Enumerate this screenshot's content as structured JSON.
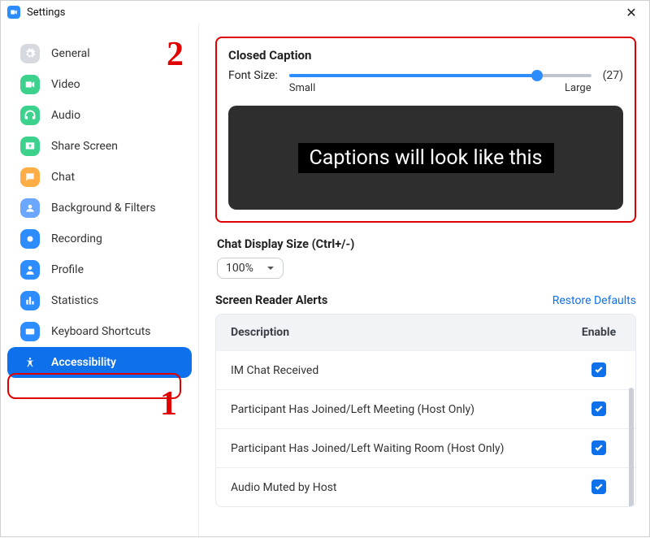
{
  "window": {
    "title": "Settings"
  },
  "sidebar": {
    "items": [
      {
        "label": "General"
      },
      {
        "label": "Video"
      },
      {
        "label": "Audio"
      },
      {
        "label": "Share Screen"
      },
      {
        "label": "Chat"
      },
      {
        "label": "Background & Filters"
      },
      {
        "label": "Recording"
      },
      {
        "label": "Profile"
      },
      {
        "label": "Statistics"
      },
      {
        "label": "Keyboard Shortcuts"
      },
      {
        "label": "Accessibility"
      }
    ]
  },
  "closed_caption": {
    "heading": "Closed Caption",
    "font_size_label": "Font Size:",
    "min_label": "Small",
    "max_label": "Large",
    "value_display": "(27)",
    "slider_percent": 82,
    "preview_text": "Captions will look like this"
  },
  "chat_display": {
    "heading": "Chat Display Size (Ctrl+/-)",
    "selected": "100%"
  },
  "screen_reader": {
    "heading": "Screen Reader Alerts",
    "restore": "Restore Defaults",
    "col_desc": "Description",
    "col_enable": "Enable",
    "rows": [
      {
        "desc": "IM Chat Received"
      },
      {
        "desc": "Participant Has Joined/Left Meeting (Host Only)"
      },
      {
        "desc": "Participant Has Joined/Left Waiting Room (Host Only)"
      },
      {
        "desc": "Audio Muted by Host"
      }
    ]
  },
  "annotations": {
    "one": "1",
    "two": "2"
  }
}
